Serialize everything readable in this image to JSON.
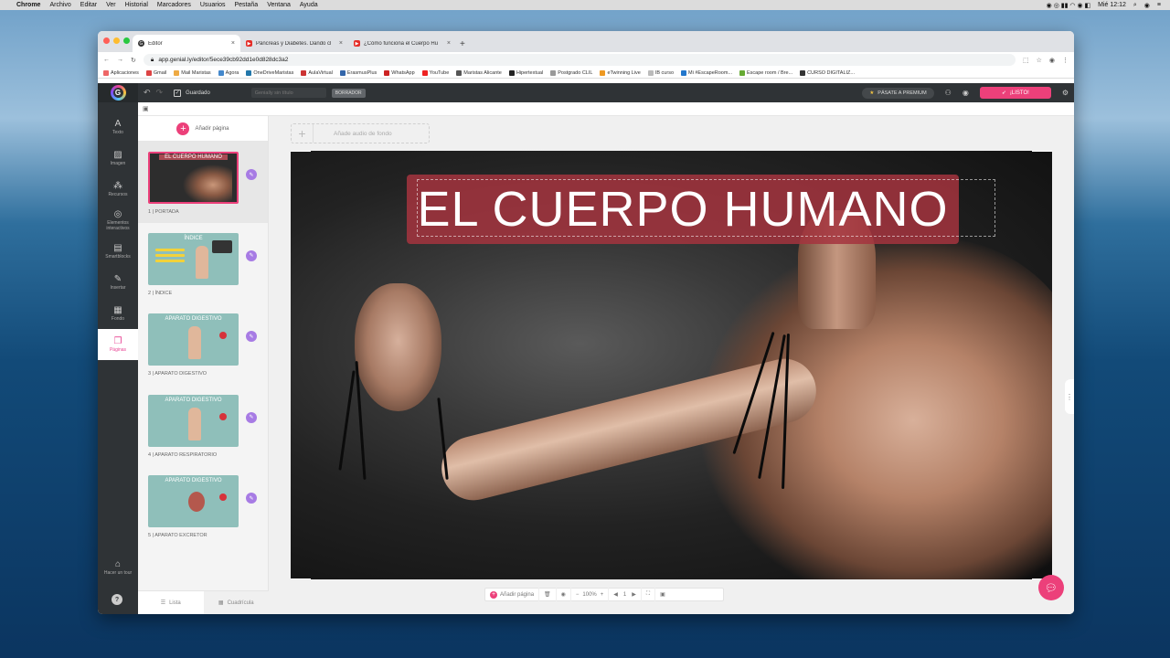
{
  "os_menu": {
    "apple": "",
    "app": "Chrome",
    "items": [
      "Archivo",
      "Editar",
      "Ver",
      "Historial",
      "Marcadores",
      "Usuarios",
      "Pestaña",
      "Ventana",
      "Ayuda"
    ],
    "clock": "Mié 12:12"
  },
  "browser": {
    "tabs": [
      {
        "title": "Editor",
        "icon": "genially-icon"
      },
      {
        "title": "Páncreas y Diabetes. Dando cl",
        "icon": "youtube-icon"
      },
      {
        "title": "¿Cómo funciona el Cuerpo Hu",
        "icon": "youtube-icon"
      }
    ],
    "url": "app.genial.ly/editor/5ece39cb92dd1e0d828dc3a2",
    "bookmarks": [
      "Aplicaciones",
      "Gmail",
      "Mail Maristas",
      "Agora",
      "OneDriveMaristas",
      "AulaVirtual",
      "ErasmusPlus",
      "WhatsApp",
      "YouTube",
      "Maristas Alicante",
      "Hipertextual",
      "Postgrado CLIL",
      "eTwinning Live",
      "IB curso",
      "Mi #EscapeRoom...",
      "Escape room / Bre...",
      "CURSO DIGITALIZ..."
    ]
  },
  "editor": {
    "saved_label": "Guardado",
    "title_placeholder": "Genially sin título",
    "draft_badge": "BORRADOR",
    "premium_label": "PÁSATE A PREMIUM",
    "ready_label": "¡LISTO!",
    "sidebar": [
      {
        "label": "Texto",
        "icon": "text-icon"
      },
      {
        "label": "Imagen",
        "icon": "image-icon"
      },
      {
        "label": "Recursos",
        "icon": "resources-icon"
      },
      {
        "label": "Elementos interactivos",
        "icon": "interactive-icon"
      },
      {
        "label": "Smartblocks",
        "icon": "smartblocks-icon"
      },
      {
        "label": "Insertar",
        "icon": "insert-icon"
      },
      {
        "label": "Fondo",
        "icon": "background-icon"
      },
      {
        "label": "Páginas",
        "icon": "pages-icon"
      }
    ],
    "tour_label": "Hacer un tour",
    "add_page_label": "Añadir página",
    "pages": [
      {
        "label": "1 | PORTADA",
        "thumb_title": "EL CUERPO HUMANO"
      },
      {
        "label": "2 | ÍNDICE",
        "thumb_title": "ÍNDICE"
      },
      {
        "label": "3 | APARATO DIGESTIVO",
        "thumb_title": "APARATO DIGESTIVO"
      },
      {
        "label": "4 | APARATO RESPIRATORIO",
        "thumb_title": "APARATO DIGESTIVO"
      },
      {
        "label": "5 | APARATO EXCRETOR",
        "thumb_title": "APARATO DIGESTIVO"
      }
    ],
    "list_tab": "Lista",
    "grid_tab": "Cuadrícula",
    "audio_label": "Añade audio de fondo",
    "slide_title": "EL CUERPO HUMANO",
    "bottom": {
      "add_page": "Añadir página",
      "zoom": "100%",
      "page": "1"
    }
  }
}
